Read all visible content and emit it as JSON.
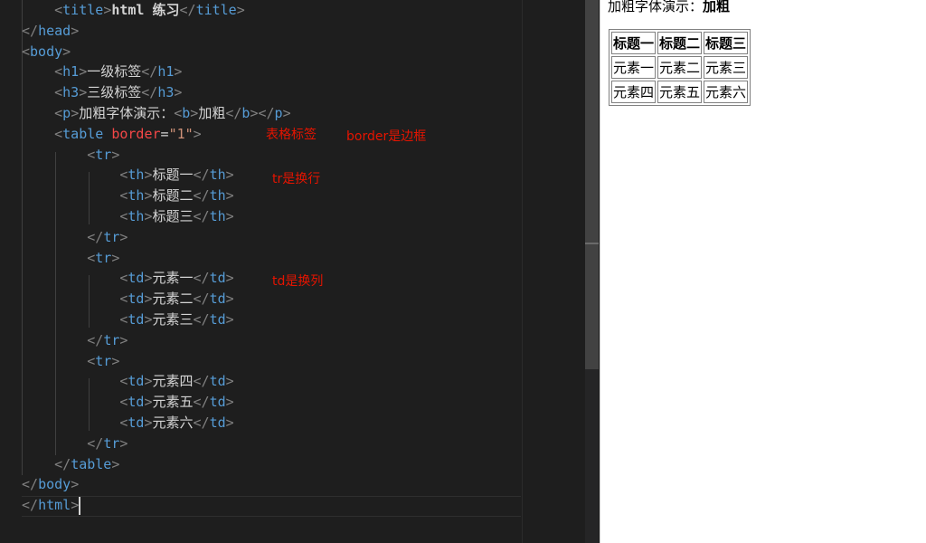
{
  "editor": {
    "lines": [
      {
        "indent": "    ",
        "parts": [
          [
            "brk",
            "<"
          ],
          [
            "tag",
            "title"
          ],
          [
            "brk",
            ">"
          ],
          [
            "bold",
            "html 练习"
          ],
          [
            "brk",
            "</"
          ],
          [
            "tag",
            "title"
          ],
          [
            "brk",
            ">"
          ]
        ]
      },
      {
        "indent": "",
        "parts": [
          [
            "brk",
            "</"
          ],
          [
            "tag",
            "head"
          ],
          [
            "brk",
            ">"
          ]
        ]
      },
      {
        "indent": "",
        "parts": [
          [
            "brk",
            "<"
          ],
          [
            "tag",
            "body"
          ],
          [
            "brk",
            ">"
          ]
        ]
      },
      {
        "indent": "    ",
        "parts": [
          [
            "brk",
            "<"
          ],
          [
            "tag",
            "h1"
          ],
          [
            "brk",
            ">"
          ],
          [
            "txt",
            "一级标签"
          ],
          [
            "brk",
            "</"
          ],
          [
            "tag",
            "h1"
          ],
          [
            "brk",
            ">"
          ]
        ]
      },
      {
        "indent": "    ",
        "parts": [
          [
            "brk",
            "<"
          ],
          [
            "tag",
            "h3"
          ],
          [
            "brk",
            ">"
          ],
          [
            "txt",
            "三级标签"
          ],
          [
            "brk",
            "</"
          ],
          [
            "tag",
            "h3"
          ],
          [
            "brk",
            ">"
          ]
        ]
      },
      {
        "indent": "    ",
        "parts": [
          [
            "brk",
            "<"
          ],
          [
            "tag",
            "p"
          ],
          [
            "brk",
            ">"
          ],
          [
            "txt",
            "加粗字体演示："
          ],
          [
            "brk",
            "<"
          ],
          [
            "tag",
            "b"
          ],
          [
            "brk",
            ">"
          ],
          [
            "txt",
            "加粗"
          ],
          [
            "brk",
            "</"
          ],
          [
            "tag",
            "b"
          ],
          [
            "brk",
            "></"
          ],
          [
            "tag",
            "p"
          ],
          [
            "brk",
            ">"
          ]
        ]
      },
      {
        "indent": "    ",
        "parts": [
          [
            "brk",
            "<"
          ],
          [
            "tag",
            "table"
          ],
          [
            "txt",
            " "
          ],
          [
            "attr",
            "border"
          ],
          [
            "txt",
            "="
          ],
          [
            "str",
            "\"1\""
          ],
          [
            "brk",
            ">"
          ]
        ]
      },
      {
        "indent": "        ",
        "parts": [
          [
            "brk",
            "<"
          ],
          [
            "tag",
            "tr"
          ],
          [
            "brk",
            ">"
          ]
        ]
      },
      {
        "indent": "            ",
        "parts": [
          [
            "brk",
            "<"
          ],
          [
            "tag",
            "th"
          ],
          [
            "brk",
            ">"
          ],
          [
            "txt",
            "标题一"
          ],
          [
            "brk",
            "</"
          ],
          [
            "tag",
            "th"
          ],
          [
            "brk",
            ">"
          ]
        ]
      },
      {
        "indent": "            ",
        "parts": [
          [
            "brk",
            "<"
          ],
          [
            "tag",
            "th"
          ],
          [
            "brk",
            ">"
          ],
          [
            "txt",
            "标题二"
          ],
          [
            "brk",
            "</"
          ],
          [
            "tag",
            "th"
          ],
          [
            "brk",
            ">"
          ]
        ]
      },
      {
        "indent": "            ",
        "parts": [
          [
            "brk",
            "<"
          ],
          [
            "tag",
            "th"
          ],
          [
            "brk",
            ">"
          ],
          [
            "txt",
            "标题三"
          ],
          [
            "brk",
            "</"
          ],
          [
            "tag",
            "th"
          ],
          [
            "brk",
            ">"
          ]
        ]
      },
      {
        "indent": "        ",
        "parts": [
          [
            "brk",
            "</"
          ],
          [
            "tag",
            "tr"
          ],
          [
            "brk",
            ">"
          ]
        ]
      },
      {
        "indent": "        ",
        "parts": [
          [
            "brk",
            "<"
          ],
          [
            "tag",
            "tr"
          ],
          [
            "brk",
            ">"
          ]
        ]
      },
      {
        "indent": "            ",
        "parts": [
          [
            "brk",
            "<"
          ],
          [
            "tag",
            "td"
          ],
          [
            "brk",
            ">"
          ],
          [
            "txt",
            "元素一"
          ],
          [
            "brk",
            "</"
          ],
          [
            "tag",
            "td"
          ],
          [
            "brk",
            ">"
          ]
        ]
      },
      {
        "indent": "            ",
        "parts": [
          [
            "brk",
            "<"
          ],
          [
            "tag",
            "td"
          ],
          [
            "brk",
            ">"
          ],
          [
            "txt",
            "元素二"
          ],
          [
            "brk",
            "</"
          ],
          [
            "tag",
            "td"
          ],
          [
            "brk",
            ">"
          ]
        ]
      },
      {
        "indent": "            ",
        "parts": [
          [
            "brk",
            "<"
          ],
          [
            "tag",
            "td"
          ],
          [
            "brk",
            ">"
          ],
          [
            "txt",
            "元素三"
          ],
          [
            "brk",
            "</"
          ],
          [
            "tag",
            "td"
          ],
          [
            "brk",
            ">"
          ]
        ]
      },
      {
        "indent": "        ",
        "parts": [
          [
            "brk",
            "</"
          ],
          [
            "tag",
            "tr"
          ],
          [
            "brk",
            ">"
          ]
        ]
      },
      {
        "indent": "        ",
        "parts": [
          [
            "brk",
            "<"
          ],
          [
            "tag",
            "tr"
          ],
          [
            "brk",
            ">"
          ]
        ]
      },
      {
        "indent": "            ",
        "parts": [
          [
            "brk",
            "<"
          ],
          [
            "tag",
            "td"
          ],
          [
            "brk",
            ">"
          ],
          [
            "txt",
            "元素四"
          ],
          [
            "brk",
            "</"
          ],
          [
            "tag",
            "td"
          ],
          [
            "brk",
            ">"
          ]
        ]
      },
      {
        "indent": "            ",
        "parts": [
          [
            "brk",
            "<"
          ],
          [
            "tag",
            "td"
          ],
          [
            "brk",
            ">"
          ],
          [
            "txt",
            "元素五"
          ],
          [
            "brk",
            "</"
          ],
          [
            "tag",
            "td"
          ],
          [
            "brk",
            ">"
          ]
        ]
      },
      {
        "indent": "            ",
        "parts": [
          [
            "brk",
            "<"
          ],
          [
            "tag",
            "td"
          ],
          [
            "brk",
            ">"
          ],
          [
            "txt",
            "元素六"
          ],
          [
            "brk",
            "</"
          ],
          [
            "tag",
            "td"
          ],
          [
            "brk",
            ">"
          ]
        ]
      },
      {
        "indent": "        ",
        "parts": [
          [
            "brk",
            "</"
          ],
          [
            "tag",
            "tr"
          ],
          [
            "brk",
            ">"
          ]
        ]
      },
      {
        "indent": "    ",
        "parts": [
          [
            "brk",
            "</"
          ],
          [
            "tag",
            "table"
          ],
          [
            "brk",
            ">"
          ]
        ]
      },
      {
        "indent": "",
        "parts": [
          [
            "brk",
            "</"
          ],
          [
            "tag",
            "body"
          ],
          [
            "brk",
            ">"
          ]
        ]
      },
      {
        "indent": "",
        "parts": [
          [
            "brk",
            "</"
          ],
          [
            "tag",
            "html"
          ],
          [
            "brk",
            ">"
          ]
        ]
      }
    ],
    "annotations": {
      "table_tag": "表格标签",
      "border": "border是边框",
      "tr": "tr是换行",
      "td": "td是换列"
    }
  },
  "preview": {
    "paragraph_text": "加粗字体演示：",
    "paragraph_bold": "加粗",
    "headers": [
      "标题一",
      "标题二",
      "标题三"
    ],
    "rows": [
      [
        "元素一",
        "元素二",
        "元素三"
      ],
      [
        "元素四",
        "元素五",
        "元素六"
      ]
    ]
  },
  "colors": {
    "tag": "#569cd6",
    "bracket": "#808080",
    "attribute": "#f44747",
    "string": "#ce9178",
    "annotation": "#e51400"
  }
}
